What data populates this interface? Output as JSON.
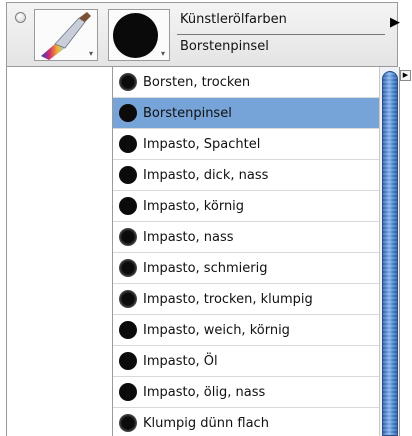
{
  "header": {
    "category": "Künstlerölfarben",
    "variant": "Borstenpinsel",
    "variant_icon": "paintbrush-icon",
    "brush_icon": "brush-dab-icon",
    "menu_arrow_icon": "triangle-right-icon"
  },
  "list": {
    "selected_color": "#76a3d8",
    "items": [
      {
        "label": "Borsten, trocken"
      },
      {
        "label": "Borstenpinsel"
      },
      {
        "label": "Impasto, Spachtel"
      },
      {
        "label": "Impasto, dick, nass"
      },
      {
        "label": "Impasto, körnig"
      },
      {
        "label": "Impasto, nass"
      },
      {
        "label": "Impasto, schmierig"
      },
      {
        "label": "Impasto, trocken, klumpig"
      },
      {
        "label": "Impasto, weich, körnig"
      },
      {
        "label": "Impasto, Öl"
      },
      {
        "label": "Impasto, ölig, nass"
      },
      {
        "label": "Klumpig dünn flach"
      }
    ]
  }
}
